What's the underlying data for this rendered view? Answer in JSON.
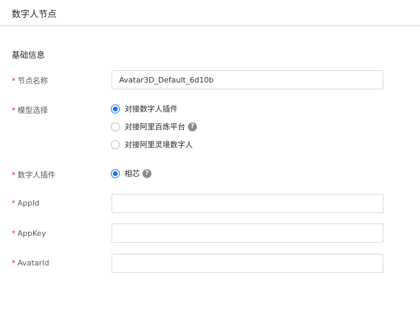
{
  "header": {
    "title": "数字人节点"
  },
  "section": {
    "title": "基础信息"
  },
  "fields": {
    "node_name": {
      "label": "节点名称",
      "value": "Avatar3D_Default_6d10b"
    },
    "model_select": {
      "label": "模型选择",
      "options": [
        {
          "label": "对接数字人插件",
          "checked": true,
          "help": false
        },
        {
          "label": "对接阿里百炼平台",
          "checked": false,
          "help": true
        },
        {
          "label": "对接阿里灵境数字人",
          "checked": false,
          "help": false
        }
      ]
    },
    "plugin": {
      "label": "数字人插件",
      "option_label": "相芯",
      "checked": true,
      "help": true
    },
    "appid": {
      "label": "AppId",
      "value": ""
    },
    "appkey": {
      "label": "AppKey",
      "value": ""
    },
    "avatarid": {
      "label": "AvatarId",
      "value": ""
    }
  },
  "required_mark": "*",
  "help_glyph": "?",
  "icons": {
    "help": "question-circle-icon"
  },
  "colors": {
    "accent": "#1a73e8",
    "required": "#e0301e",
    "border": "#d9d9d9"
  }
}
